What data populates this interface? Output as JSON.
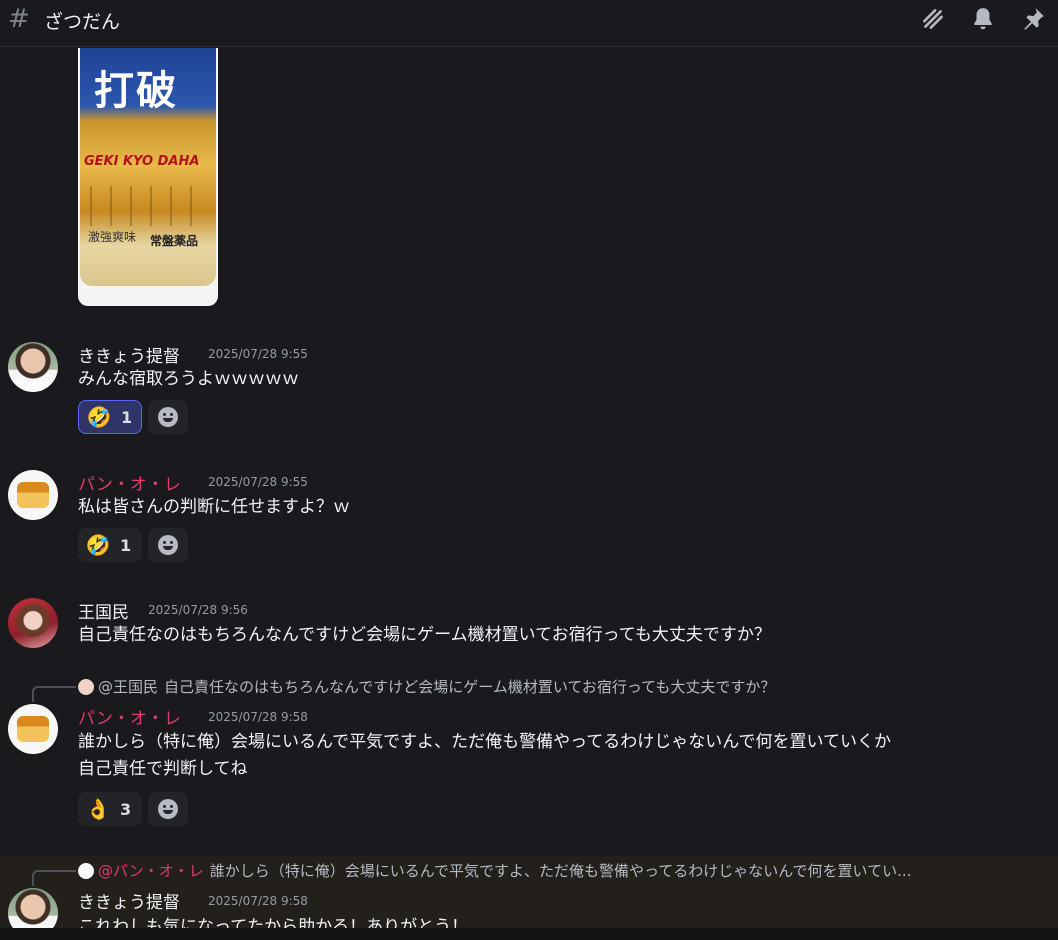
{
  "header": {
    "channel_name": "ざつだん",
    "icons": [
      "threads-icon",
      "bell-icon",
      "pin-icon"
    ]
  },
  "attachment": {
    "title": "打破",
    "subtitle": "GEKI KYO DAHA",
    "taste": "激強爽味",
    "brand": "常盤薬品"
  },
  "messages": [
    {
      "author": "ききょう提督",
      "author_color": "#f2f3f5",
      "time": "2025/07/28 9:55",
      "text": "みんな宿取ろうよｗｗｗｗｗ",
      "reactions": [
        {
          "emoji": "🤣",
          "count": "1",
          "active": true
        }
      ]
    },
    {
      "author": "パン・オ・レ",
      "author_color": "#e23b6e",
      "time": "2025/07/28 9:55",
      "text": "私は皆さんの判断に任せますよ？ｗ",
      "reactions": [
        {
          "emoji": "🤣",
          "count": "1",
          "active": false
        }
      ]
    },
    {
      "author": "王国民",
      "author_color": "#f2f3f5",
      "time": "2025/07/28 9:56",
      "text": "自己責任なのはもちろんなんですけど会場にゲーム機材置いてお宿行っても大丈夫ですか？"
    },
    {
      "reply_to": {
        "mention": "@王国民",
        "text": "自己責任なのはもちろんなんですけど会場にゲーム機材置いてお宿行っても大丈夫ですか？"
      },
      "author": "パン・オ・レ",
      "author_color": "#e23b6e",
      "time": "2025/07/28 9:58",
      "text_line1": "誰かしら（特に俺）会場にいるんで平気ですよ、ただ俺も警備やってるわけじゃないんで何を置いていくか",
      "text_line2": "自己責任で判断してね",
      "reactions": [
        {
          "emoji": "👌",
          "count": "3",
          "active": false
        }
      ]
    },
    {
      "reply_to": {
        "mention": "@パン・オ・レ",
        "text": "誰かしら（特に俺）会場にいるんで平気ですよ、ただ俺も警備やってるわけじゃないんで何を置いてい..."
      },
      "author": "ききょう提督",
      "author_color": "#f2f3f5",
      "time": "2025/07/28 9:58",
      "text": "これわしも気になってたから助かる！ありがとう！"
    }
  ]
}
